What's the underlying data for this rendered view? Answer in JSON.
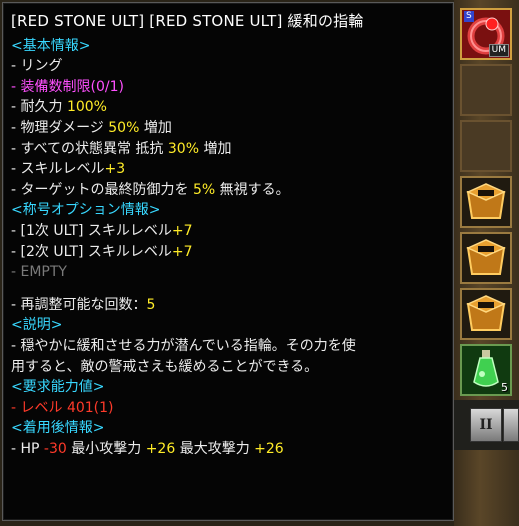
{
  "title": "[RED STONE ULT] [RED STONE ULT] 緩和の指輪",
  "sections": {
    "basic": {
      "header": "<基本情報>",
      "type": "- リング",
      "equip_limit": "- 装備数制限(0/1)",
      "durability_label": "- 耐久力 ",
      "durability_value": "100%",
      "physdmg_label": "- 物理ダメージ ",
      "physdmg_value": "50%",
      "physdmg_suffix": " 増加",
      "resist_label": "- すべての状態異常 抵抗 ",
      "resist_value": "30%",
      "resist_suffix": " 増加",
      "skill_label": "- スキルレベル",
      "skill_value": "+3",
      "ignore_label": "- ターゲットの最終防御力を ",
      "ignore_value": "5%",
      "ignore_suffix": " 無視する。"
    },
    "title_option": {
      "header": "<称号オプション情報>",
      "opt1_label": "- [1次 ULT] スキルレベル",
      "opt1_value": "+7",
      "opt2_label": "- [2次 ULT] スキルレベル",
      "opt2_value": "+7",
      "empty": "- EMPTY"
    },
    "readjust": {
      "label": "- 再調整可能な回数：",
      "value": "5"
    },
    "description": {
      "header": "<説明>",
      "line1": "- 穏やかに緩和させる力が潜んでいる指輪。その力を使",
      "line2": "用すると、敵の警戒さえも緩めることができる。"
    },
    "requirement": {
      "header": "<要求能力値>",
      "level": "- レベル 401(1)"
    },
    "after_equip": {
      "header": "<着用後情報>",
      "hp_label": "- HP ",
      "hp_value": "-30",
      "min_label": " 最小攻撃力 ",
      "min_value": "+26",
      "max_label": " 最大攻撃力 ",
      "max_value": "+26"
    }
  },
  "inventory": {
    "ring_badge_s": "S",
    "ring_badge_um": "UM",
    "potion_count": "5"
  },
  "colors": {
    "header": "#38d8ff",
    "highlight": "#ffec28",
    "limit": "#ff50ff",
    "warning": "#ff3a2a"
  }
}
